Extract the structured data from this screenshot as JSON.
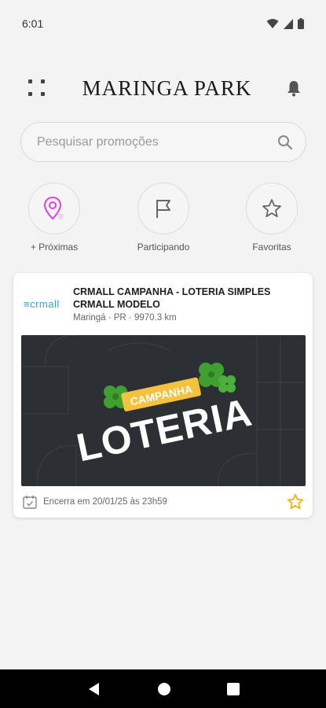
{
  "status_bar": {
    "time": "6:01"
  },
  "header": {
    "brand": "MARINGA PARK"
  },
  "search": {
    "placeholder": "Pesquisar promoções"
  },
  "actions": [
    {
      "label": "+ Próximas",
      "icon": "location-pin-icon"
    },
    {
      "label": "Participando",
      "icon": "flag-icon"
    },
    {
      "label": "Favoritas",
      "icon": "star-icon"
    }
  ],
  "promotion": {
    "logo_text": "crmall",
    "title": "CRMALL CAMPANHA - LOTERIA SIMPLES CRMALL MODELO",
    "location": "Maringá · PR · 9970.3 km",
    "banner": {
      "tag": "CAMPANHA",
      "headline": "LOTERIA"
    },
    "ends": "Encerra em 20/01/25 às 23h59"
  },
  "colors": {
    "accent_pink": "#e040e0",
    "star_yellow": "#f4b400",
    "banner_bg": "#2c2f33",
    "tag_yellow": "#f6c23b",
    "clover_green": "#3f9f2f"
  }
}
